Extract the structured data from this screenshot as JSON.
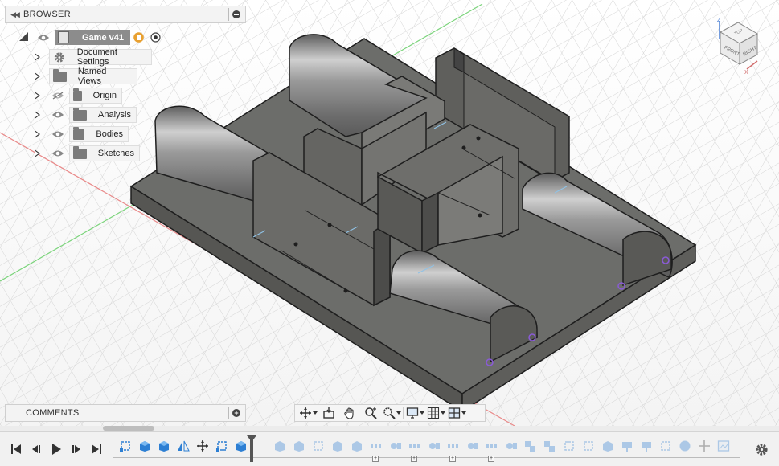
{
  "browser": {
    "title": "BROWSER",
    "root": {
      "label": "Game v41"
    },
    "items": [
      {
        "label": "Document Settings",
        "icon": "gear-icon"
      },
      {
        "label": "Named Views",
        "icon": "folder-icon"
      },
      {
        "label": "Origin",
        "icon": "folder-icon",
        "hidden": true
      },
      {
        "label": "Analysis",
        "icon": "folder-icon"
      },
      {
        "label": "Bodies",
        "icon": "folder-icon"
      },
      {
        "label": "Sketches",
        "icon": "folder-icon"
      }
    ]
  },
  "comments": {
    "title": "COMMENTS"
  },
  "viewcube": {
    "front": "FRONT",
    "right": "RIGHT",
    "top": "TOP",
    "axis_x": "X",
    "axis_z": "Z"
  },
  "navbar": {
    "tools": [
      "orbit-icon",
      "look-at-icon",
      "pan-icon",
      "zoom-icon",
      "fit-icon",
      "display-settings-icon",
      "grid-icon",
      "viewports-icon"
    ]
  },
  "timeline": {
    "controls": [
      "go-to-start-icon",
      "step-back-icon",
      "play-icon",
      "step-forward-icon",
      "go-to-end-icon"
    ],
    "colors": {
      "active": "#2d7fd3",
      "inactive": "#9fb7d3"
    }
  }
}
